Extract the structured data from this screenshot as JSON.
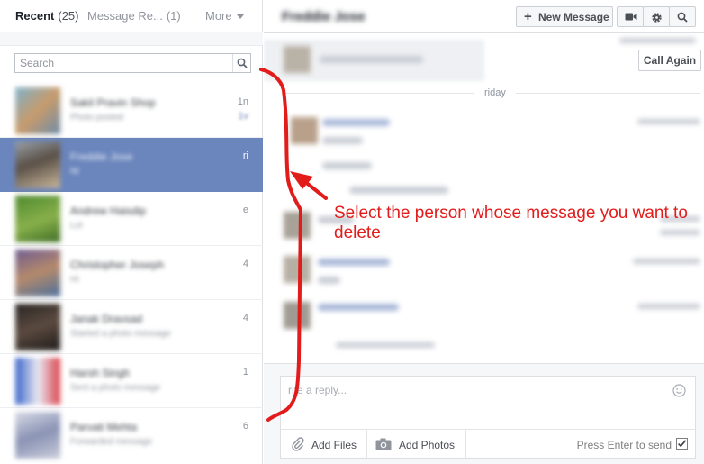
{
  "tabs": {
    "recent_label": "Recent",
    "recent_count": "(25)",
    "requests_label": "Message Re...",
    "requests_count": "(1)",
    "more_label": "More"
  },
  "search": {
    "placeholder": "Search"
  },
  "conversations": [
    {
      "name": "Sakil Pravin Shop",
      "snippet": "Photo posted",
      "time": "1n",
      "time_extra": "1v",
      "selected": false
    },
    {
      "name": "Freddie Jose",
      "snippet": "Nl",
      "time": "ri",
      "selected": true
    },
    {
      "name": "Andrew Haisdip",
      "snippet": "Lol",
      "time": "e",
      "selected": false
    },
    {
      "name": "Christopher Joseph",
      "snippet": "Hi",
      "time": "4",
      "selected": false
    },
    {
      "name": "Janak Dravsad",
      "snippet": "Started a photo message",
      "time": "4",
      "selected": false
    },
    {
      "name": "Harsh Singh",
      "snippet": "Sent a photo message",
      "time": "1",
      "selected": false
    },
    {
      "name": "Parvati Mehta",
      "snippet": "Forwarded message",
      "time": "6",
      "selected": false
    }
  ],
  "header": {
    "thread_name": "Freddie Jose",
    "new_message_label": "New Message"
  },
  "messages": {
    "call_again_label": "Call Again",
    "day_divider": "riday"
  },
  "composer": {
    "placeholder": "rite a reply...",
    "add_files_label": "Add Files",
    "add_photos_label": "Add Photos",
    "enter_to_send_label": "Press Enter to send"
  },
  "annotation": {
    "text": "Select the person whose message you want to delete",
    "color": "#e21b1b"
  },
  "colors": {
    "selected_row": "#6b86bd",
    "border": "#dddfe2",
    "muted_text": "#90949c"
  }
}
